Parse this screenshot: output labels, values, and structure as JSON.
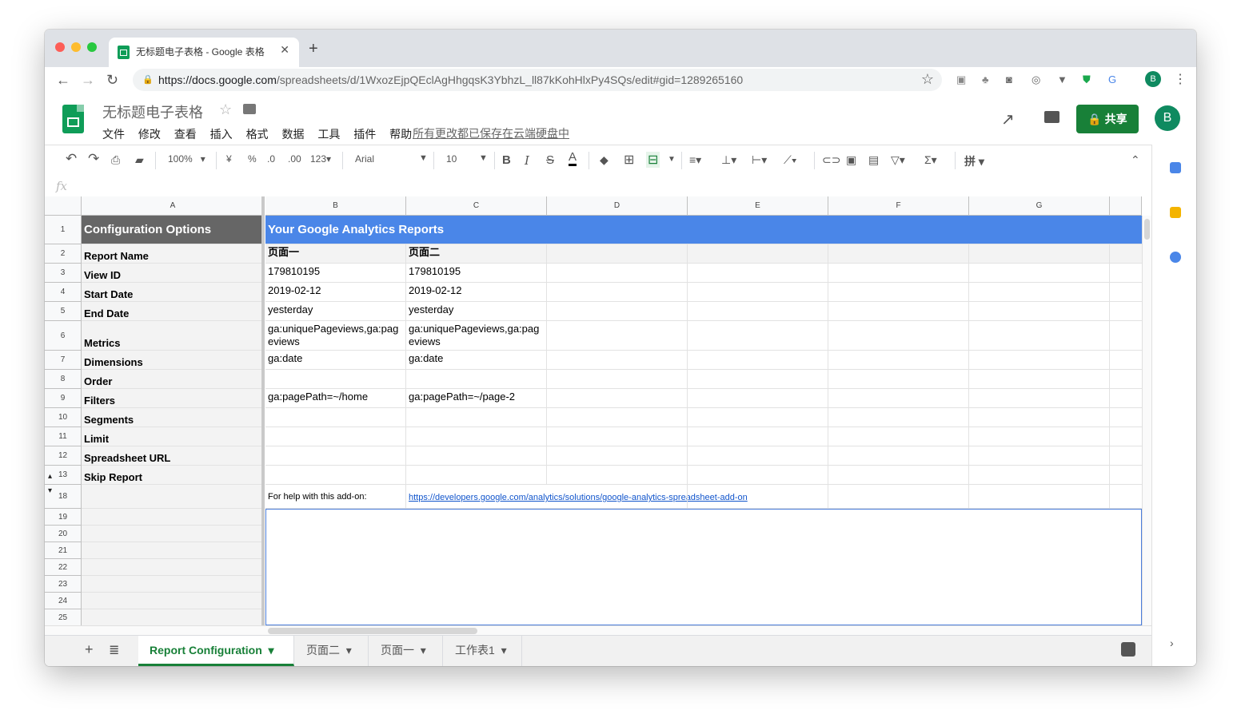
{
  "browser": {
    "tab_title": "无标题电子表格 - Google 表格",
    "url_host": "https://docs.google.com",
    "url_path": "/spreadsheets/d/1WxozEjpQEclAgHhgqsK3YbhzL_ll87kKohHlxPy4SQs/edit#gid=1289265160",
    "profile_initial": "B"
  },
  "doc": {
    "title": "无标题电子表格",
    "menu": [
      "文件",
      "修改",
      "查看",
      "插入",
      "格式",
      "数据",
      "工具",
      "插件",
      "帮助"
    ],
    "save_status": "所有更改都已保存在云端硬盘中",
    "share_label": "共享",
    "account_initial": "B"
  },
  "toolbar": {
    "zoom": "100%",
    "currency": "¥",
    "percent": "%",
    "dec_less": ".0",
    "dec_more": ".00",
    "format_more": "123",
    "font": "Arial",
    "font_size": "10",
    "bold": "B",
    "italic": "I",
    "strike": "S",
    "text_color": "A",
    "pinyin": "拼"
  },
  "columns": [
    "A",
    "B",
    "C",
    "D",
    "E",
    "F",
    "G"
  ],
  "rows": [
    {
      "num": "1",
      "a": "Configuration Options",
      "b": "Your Google Analytics Reports",
      "c": ""
    },
    {
      "num": "2",
      "a": "Report Name",
      "b": "页面一",
      "c": "页面二"
    },
    {
      "num": "3",
      "a": "View ID",
      "b": "179810195",
      "c": "179810195"
    },
    {
      "num": "4",
      "a": "Start Date",
      "b": "2019-02-12",
      "c": "2019-02-12"
    },
    {
      "num": "5",
      "a": "End Date",
      "b": "yesterday",
      "c": "yesterday"
    },
    {
      "num": "6",
      "a": "Metrics",
      "b": "ga:uniquePageviews,ga:pageviews",
      "c": "ga:uniquePageviews,ga:pageviews"
    },
    {
      "num": "7",
      "a": "Dimensions",
      "b": "ga:date",
      "c": "ga:date"
    },
    {
      "num": "8",
      "a": "Order",
      "b": "",
      "c": ""
    },
    {
      "num": "9",
      "a": "Filters",
      "b": "ga:pagePath=~/home",
      "c": "ga:pagePath=~/page-2"
    },
    {
      "num": "10",
      "a": "Segments",
      "b": "",
      "c": ""
    },
    {
      "num": "11",
      "a": "Limit",
      "b": "",
      "c": ""
    },
    {
      "num": "12",
      "a": "Spreadsheet URL",
      "b": "",
      "c": ""
    },
    {
      "num": "13",
      "a": "Skip Report",
      "b": "",
      "c": ""
    },
    {
      "num": "18",
      "a": "",
      "b": "For help with this add-on:",
      "c": "https://developers.google.com/analytics/solutions/google-analytics-spreadsheet-add-on"
    },
    {
      "num": "19",
      "a": "",
      "b": "",
      "c": ""
    },
    {
      "num": "20",
      "a": "",
      "b": "",
      "c": ""
    },
    {
      "num": "21",
      "a": "",
      "b": "",
      "c": ""
    },
    {
      "num": "22",
      "a": "",
      "b": "",
      "c": ""
    },
    {
      "num": "23",
      "a": "",
      "b": "",
      "c": ""
    },
    {
      "num": "24",
      "a": "",
      "b": "",
      "c": ""
    },
    {
      "num": "25",
      "a": "",
      "b": "",
      "c": ""
    }
  ],
  "sheets": [
    "Report Configuration",
    "页面二",
    "页面一",
    "工作表1"
  ],
  "colors": {
    "header_dark": "#666666",
    "header_blue": "#4a86e8",
    "accent": "#188038"
  }
}
